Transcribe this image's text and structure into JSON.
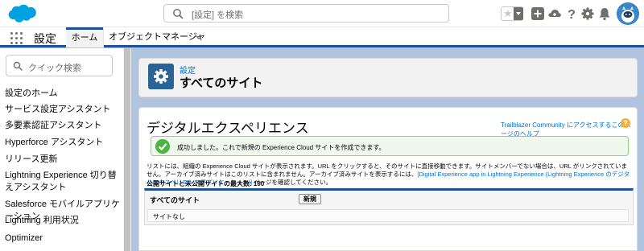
{
  "header": {
    "search_placeholder": "[設定] を検索",
    "icons": [
      "salesforce-logo",
      "favorite-star",
      "favorites-dropdown",
      "global-actions",
      "trailhead",
      "help",
      "setup-gear",
      "notifications",
      "user-avatar"
    ]
  },
  "context_bar": {
    "app_name": "設定",
    "tabs": [
      {
        "label": "ホーム",
        "active": true
      },
      {
        "label": "オブジェクトマネージャ",
        "active": false
      }
    ]
  },
  "sidebar": {
    "quick_find_placeholder": "クイック検索",
    "items": [
      {
        "label": "設定のホーム"
      },
      {
        "label": "サービス設定アシスタント"
      },
      {
        "label": "多要素認証アシスタント"
      },
      {
        "label": "Hyperforce アシスタント"
      },
      {
        "label": "リリース更新"
      },
      {
        "label": "Lightning Experience 切り替えアシスタント"
      },
      {
        "label": "Salesforce モバイルアプリケーション"
      },
      {
        "label": "Lightning 利用状況"
      },
      {
        "label": "Optimizer"
      }
    ]
  },
  "page_header": {
    "breadcrumb": "設定",
    "title": "すべてのサイト"
  },
  "content": {
    "heading": "デジタルエクスペリエンス",
    "help_link": "Trailblazer Community にアクセスするこのページのヘルプ",
    "help_icon": "?",
    "success_message": "成功しました。これで新規の Experience Cloud サイトを作成できます。",
    "description_1": "リストには、組織の Experience Cloud サイトが表示されます。URL をクリックすると、そのサイトに直接移動できます。サイトメンバーでない場合は、URL がリンクされていません。アーカイブ済みサイトはこのリストに含まれません。アーカイブ済みサイトを表示するには、",
    "description_link": "[Digital Experience app in Lightning Experience (Lightning Experience のデジタルエクスペリエンスアプリケーション)]",
    "description_2": " ページを確認してください。",
    "max_count": "公開サイトと未公開サイトの最大数: 100",
    "list": {
      "title": "すべてのサイト",
      "new_button": "新規",
      "empty_text": "サイトなし"
    }
  },
  "colors": {
    "brand_blue": "#1b5297",
    "link": "#0070d2",
    "success_green": "#4bb543",
    "background": "#b0c4df"
  }
}
